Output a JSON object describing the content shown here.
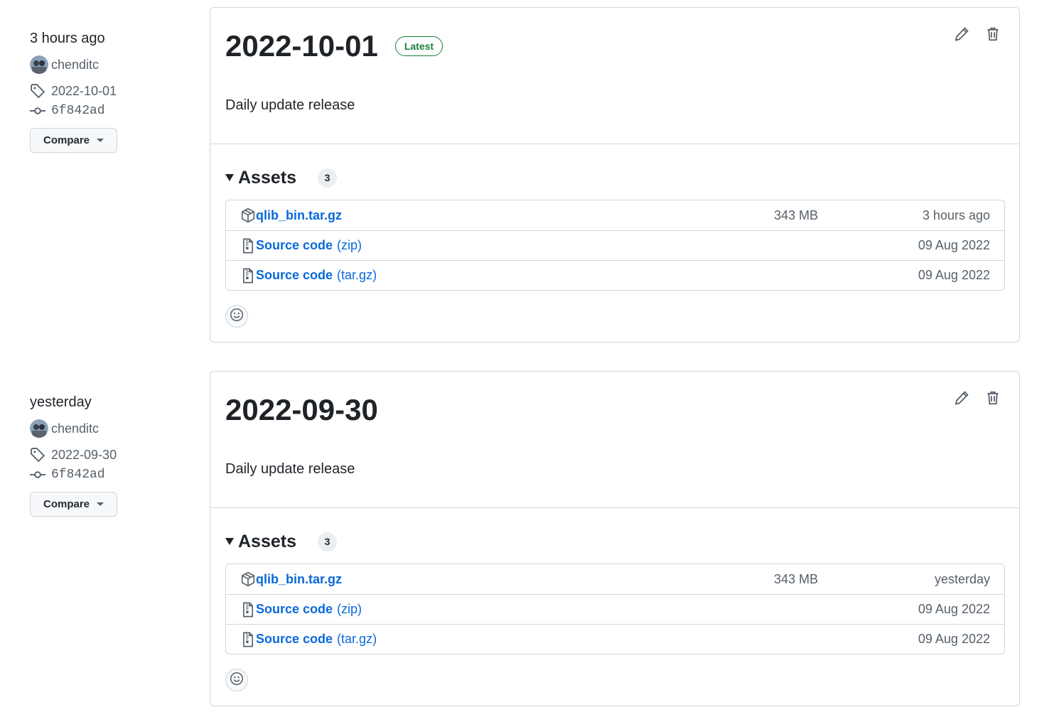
{
  "releases": [
    {
      "when": "3 hours ago",
      "author": "chenditc",
      "tag": "2022-10-01",
      "commit": "6f842ad",
      "compare_label": "Compare",
      "title": "2022-10-01",
      "latest_label": "Latest",
      "body": "Daily update release",
      "assets_label": "Assets",
      "assets_count": "3",
      "assets": [
        {
          "name": "qlib_bin.tar.gz",
          "suffix": "",
          "size": "343 MB",
          "date": "3 hours ago",
          "icon": "package-icon"
        },
        {
          "name": "Source code",
          "suffix": "(zip)",
          "size": "",
          "date": "09 Aug 2022",
          "icon": "file-zip-icon"
        },
        {
          "name": "Source code",
          "suffix": "(tar.gz)",
          "size": "",
          "date": "09 Aug 2022",
          "icon": "file-zip-icon"
        }
      ]
    },
    {
      "when": "yesterday",
      "author": "chenditc",
      "tag": "2022-09-30",
      "commit": "6f842ad",
      "compare_label": "Compare",
      "title": "2022-09-30",
      "latest_label": "",
      "body": "Daily update release",
      "assets_label": "Assets",
      "assets_count": "3",
      "assets": [
        {
          "name": "qlib_bin.tar.gz",
          "suffix": "",
          "size": "343 MB",
          "date": "yesterday",
          "icon": "package-icon"
        },
        {
          "name": "Source code",
          "suffix": "(zip)",
          "size": "",
          "date": "09 Aug 2022",
          "icon": "file-zip-icon"
        },
        {
          "name": "Source code",
          "suffix": "(tar.gz)",
          "size": "",
          "date": "09 Aug 2022",
          "icon": "file-zip-icon"
        }
      ]
    }
  ],
  "colors": {
    "link": "#0969da",
    "latest": "#1a7f37",
    "border": "#d0d7de",
    "muted": "#57606a"
  }
}
